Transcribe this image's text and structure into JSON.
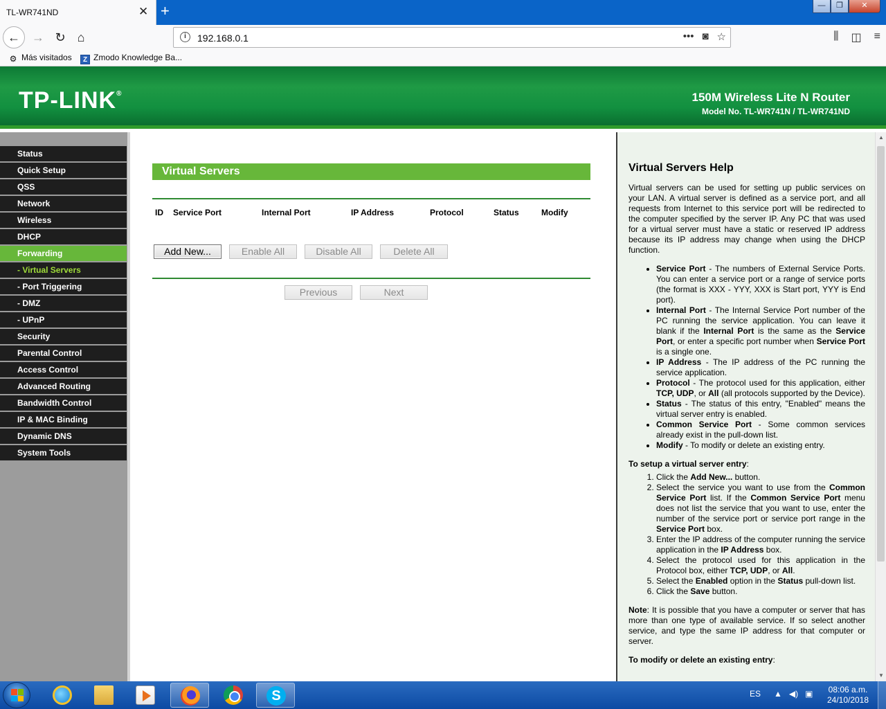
{
  "browser": {
    "tab_title": "TL-WR741ND",
    "tab_close": "✕",
    "new_tab": "+",
    "url": "192.168.0.1",
    "url_info": "i",
    "bookmarks": [
      {
        "label": "Más visitados",
        "icon": "gear-icon"
      },
      {
        "label": "Zmodo Knowledge Ba...",
        "icon": "zmodo-icon"
      }
    ],
    "window_controls": {
      "minimize": "—",
      "maximize": "❐",
      "close": "✕"
    }
  },
  "router": {
    "logo": "TP-LINK",
    "logo_mark": "®",
    "product_name": "150M Wireless Lite N Router",
    "model_no": "Model No. TL-WR741N / TL-WR741ND",
    "brand_green": "#67b73a",
    "header_green": "#0d7a35"
  },
  "menu": [
    {
      "label": "Status"
    },
    {
      "label": "Quick Setup"
    },
    {
      "label": "QSS"
    },
    {
      "label": "Network"
    },
    {
      "label": "Wireless"
    },
    {
      "label": "DHCP"
    },
    {
      "label": "Forwarding"
    },
    {
      "label": "- Virtual Servers"
    },
    {
      "label": "- Port Triggering"
    },
    {
      "label": "- DMZ"
    },
    {
      "label": "- UPnP"
    },
    {
      "label": "Security"
    },
    {
      "label": "Parental Control"
    },
    {
      "label": "Access Control"
    },
    {
      "label": "Advanced Routing"
    },
    {
      "label": "Bandwidth Control"
    },
    {
      "label": "IP & MAC Binding"
    },
    {
      "label": "Dynamic DNS"
    },
    {
      "label": "System Tools"
    }
  ],
  "main": {
    "title": "Virtual Servers",
    "columns": [
      "ID",
      "Service Port",
      "Internal Port",
      "IP Address",
      "Protocol",
      "Status",
      "Modify"
    ],
    "buttons": {
      "add_new": "Add New...",
      "enable_all": "Enable All",
      "disable_all": "Disable All",
      "delete_all": "Delete All",
      "previous": "Previous",
      "next": "Next"
    }
  },
  "help": {
    "title": "Virtual Servers Help",
    "intro": "Virtual servers can be used for setting up public services on your LAN. A virtual server is defined as a service port, and all requests from Internet to this service port will be redirected to the computer specified by the server IP. Any PC that was used for a virtual server must have a static or reserved IP address because its IP address may change when using the DHCP function.",
    "b1_term": "Service Port",
    "b1_text": " - The numbers of External Service Ports. You can enter a service port or a range of service ports (the format is XXX - YYY, XXX is Start port, YYY is End port).",
    "b2_term": "Internal Port",
    "b2_t1": " - The Internal Service Port number of the PC running the service application. You can leave it blank if the ",
    "b2_b1": "Internal Port",
    "b2_t2": " is the same as the ",
    "b2_b2": "Service Port",
    "b2_t3": ", or enter a specific port number when ",
    "b2_b3": "Service Port",
    "b2_t4": " is a single one.",
    "b3_term": "IP Address",
    "b3_text": " - The IP address of the PC running the service application.",
    "b4_term": "Protocol",
    "b4_t1": " - The protocol used for this application, either ",
    "b4_b1": "TCP, UDP",
    "b4_t2": ", or ",
    "b4_b2": "All",
    "b4_t3": " (all protocols supported by the Device).",
    "b5_term": "Status",
    "b5_text": " - The status of this entry, \"Enabled\" means the virtual server entry is enabled.",
    "b6_term": "Common Service Port",
    "b6_text": " - Some common services already exist in the pull-down list.",
    "b7_term": "Modify",
    "b7_text": " - To modify or delete an existing entry.",
    "setup_heading": "To setup a virtual server entry",
    "colon": ":",
    "s1_t1": "Click the ",
    "s1_b1": "Add New...",
    "s1_t2": " button.",
    "s2_t1": "Select the service you want to use from the ",
    "s2_b1": "Common Service Port",
    "s2_t2": " list. If the ",
    "s2_b2": "Common Service Port",
    "s2_t3": " menu does not list the service that you want to use, enter the number of the service port or service port range in the ",
    "s2_b3": "Service Port",
    "s2_t4": " box.",
    "s3_t1": "Enter the IP address of the computer running the service application in the ",
    "s3_b1": "IP Address",
    "s3_t2": " box.",
    "s4_t1": "Select the protocol used for this application in the Protocol box, either ",
    "s4_b1": "TCP, UDP",
    "s4_t2": ", or ",
    "s4_b2": "All",
    "s4_t3": ".",
    "s5_t1": "Select the ",
    "s5_b1": "Enabled",
    "s5_t2": " option in the ",
    "s5_b2": "Status",
    "s5_t3": " pull-down list.",
    "s6_t1": "Click the ",
    "s6_b1": "Save",
    "s6_t2": " button.",
    "note_term": "Note",
    "note_text": ": It is possible that you have a computer or server that has more than one type of available service. If so select another service, and type the same IP address for that computer or server.",
    "modify_heading": "To modify or delete an existing entry"
  },
  "taskbar": {
    "lang": "ES",
    "time": "08:06 a.m.",
    "date": "24/10/2018"
  }
}
